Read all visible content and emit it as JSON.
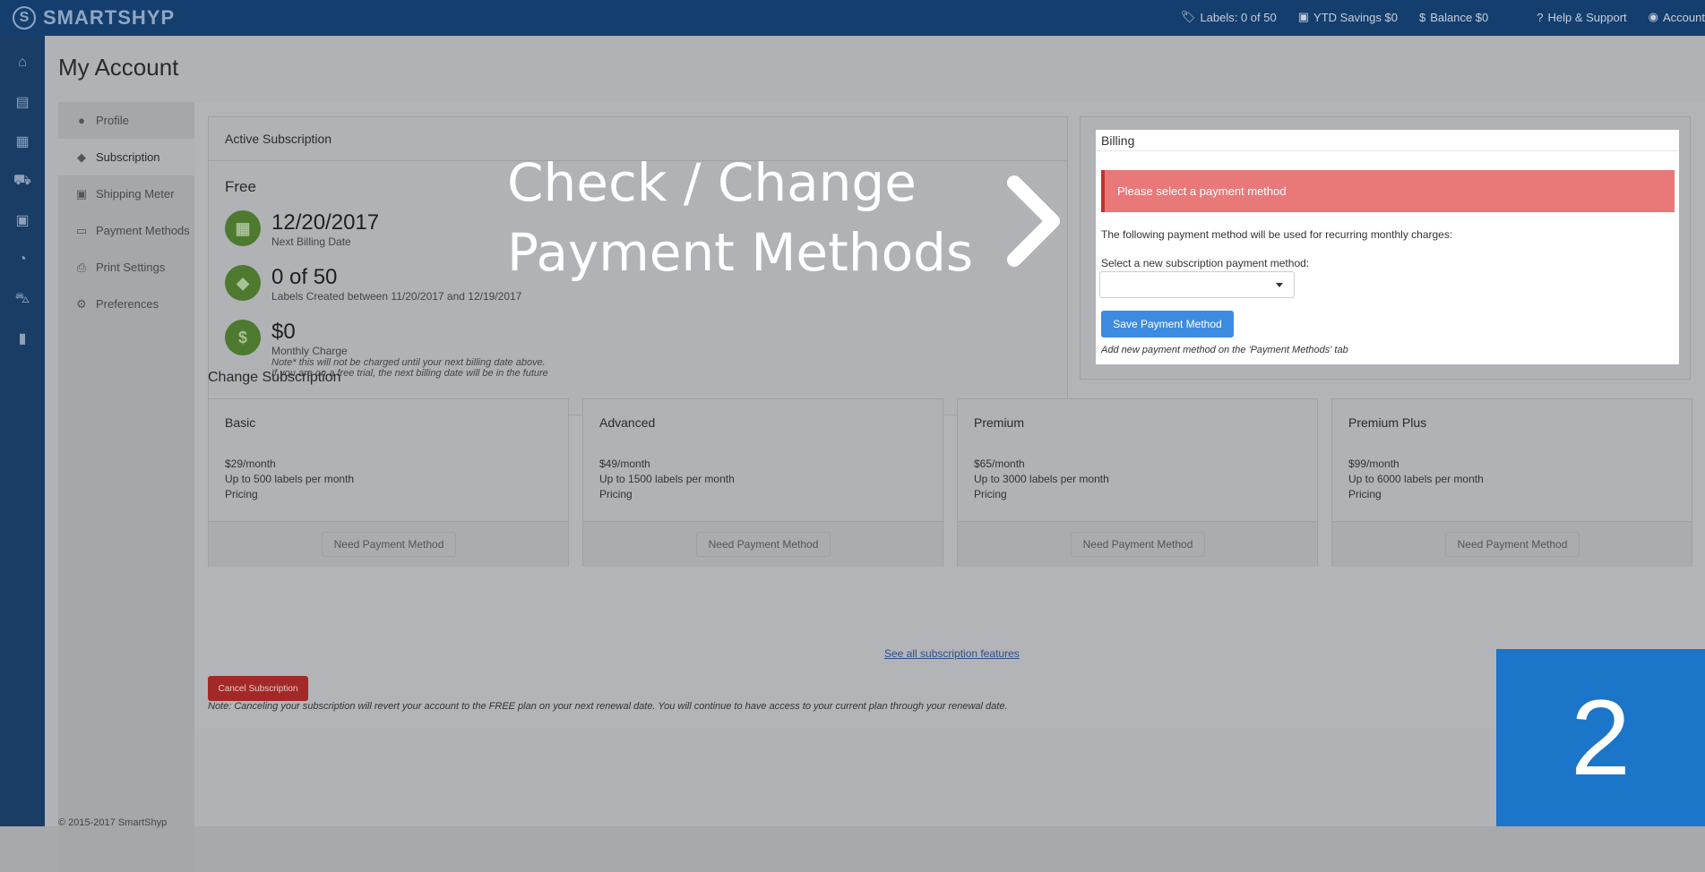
{
  "brand": {
    "name": "SMARTSHYP",
    "mark": "S"
  },
  "topnav": {
    "labels": "Labels: 0 of 50",
    "ytd": "YTD Savings $0",
    "balance": "Balance $0",
    "help": "Help & Support",
    "account": "Account"
  },
  "sidebar_icons": [
    "home-icon",
    "store-icon",
    "calendar-icon",
    "truck-icon",
    "address-book-icon",
    "pie-chart-icon",
    "cart-icon",
    "lock-icon"
  ],
  "page_title": "My Account",
  "tabs": [
    {
      "label": "Profile",
      "icon": "user-icon"
    },
    {
      "label": "Subscription",
      "icon": "ticket-icon"
    },
    {
      "label": "Shipping Meter",
      "icon": "money-icon"
    },
    {
      "label": "Payment Methods",
      "icon": "credit-card-icon"
    },
    {
      "label": "Print Settings",
      "icon": "printer-icon"
    },
    {
      "label": "Preferences",
      "icon": "gears-icon"
    }
  ],
  "active_subscription": {
    "title": "Active Subscription",
    "plan": "Free",
    "billing_date": "12/20/2017",
    "billing_date_label": "Next Billing Date",
    "labels_count": "0 of 50",
    "labels_caption": "Labels Created between 11/20/2017 and 12/19/2017",
    "charge": "$0",
    "charge_label": "Monthly Charge",
    "note1": "Note* this will not be charged until your next billing date above.",
    "note2": "If you are on a free trial, the next billing date will be in the future"
  },
  "billing": {
    "title": "Billing",
    "alert": "Please select a payment method",
    "info": "The following payment method will be used for recurring monthly charges:",
    "select_label": "Select a new subscription payment method:",
    "save_button": "Save Payment Method",
    "add_note": "Add new payment method on the 'Payment Methods' tab"
  },
  "change_subscription": {
    "title": "Change Subscription",
    "plans": [
      {
        "name": "Basic",
        "price": "$29/month",
        "limit": "Up to 500 labels per month",
        "pricing": "Pricing",
        "button": "Need Payment Method"
      },
      {
        "name": "Advanced",
        "price": "$49/month",
        "limit": "Up to 1500 labels per month",
        "pricing": "Pricing",
        "button": "Need Payment Method"
      },
      {
        "name": "Premium",
        "price": "$65/month",
        "limit": "Up to 3000 labels per month",
        "pricing": "Pricing",
        "button": "Need Payment Method"
      },
      {
        "name": "Premium Plus",
        "price": "$99/month",
        "limit": "Up to 6000 labels per month",
        "pricing": "Pricing",
        "button": "Need Payment Method"
      }
    ],
    "see_all": "See all subscription features"
  },
  "cancel": {
    "button": "Cancel Subscription",
    "note": "Note: Canceling your subscription will revert your account to the FREE plan on your next renewal date. You will continue to have access to your current plan through your renewal date."
  },
  "footer": "© 2015-2017 SmartShyp",
  "overlay": {
    "line1": "Check / Change",
    "line2": "Payment Methods",
    "step": "2"
  }
}
